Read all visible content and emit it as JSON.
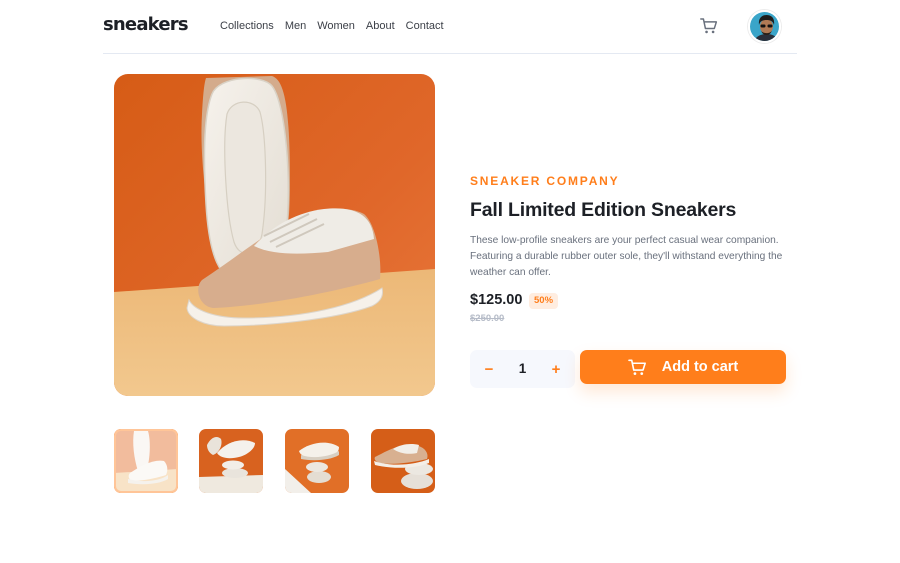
{
  "header": {
    "logo": "sneakers",
    "nav": [
      "Collections",
      "Men",
      "Women",
      "About",
      "Contact"
    ]
  },
  "product": {
    "company": "SNEAKER COMPANY",
    "title": "Fall Limited Edition Sneakers",
    "description": "These low-profile sneakers are your perfect casual wear companion. Featuring a durable rubber outer sole, they'll withstand everything the weather can offer.",
    "price": "$125.00",
    "discount": "50%",
    "old_price": "$250.00",
    "quantity": "1",
    "minus_label": "−",
    "plus_label": "+",
    "add_to_cart": "Add to cart"
  },
  "gallery": {
    "active_thumbnail": 1,
    "thumbnail_count": 4
  },
  "colors": {
    "accent": "#ff7e1b",
    "accent_pale": "#ffede0",
    "text_dark": "#1d2026",
    "text_muted": "#69707d",
    "border": "#e4e9f2"
  }
}
